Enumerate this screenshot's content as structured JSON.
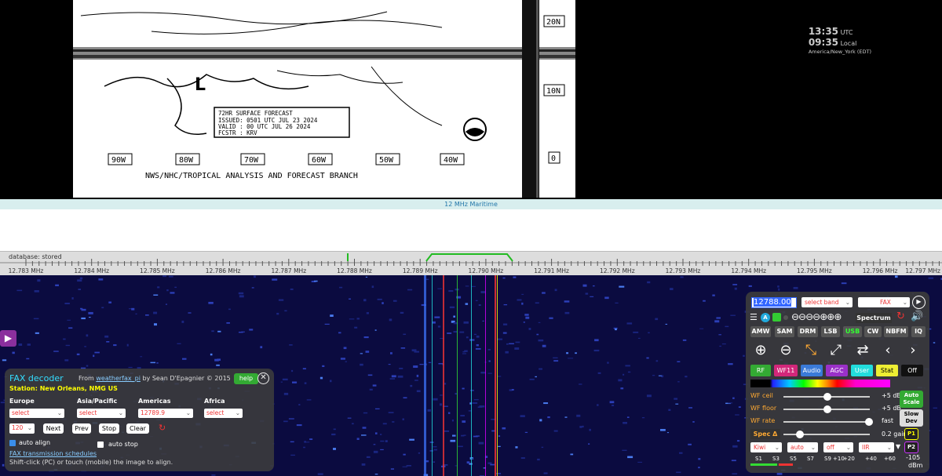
{
  "fax_image": {
    "title_text": "NWS/NHC/TROPICAL ANALYSIS AND FORECAST BRANCH",
    "forecast_box": [
      "72HR SURFACE FORECAST",
      "ISSUED: 0501 UTC JUL 23 2024",
      "VALID : 00 UTC JUL 26 2024",
      "FCSTR : KRV"
    ],
    "longitudes": [
      "90W",
      "80W",
      "70W",
      "60W",
      "50W",
      "40W"
    ],
    "latitudes": [
      "20N",
      "10N",
      "0"
    ]
  },
  "clock": {
    "utc_time": "13:35",
    "utc_label": "UTC",
    "local_time": "09:35",
    "local_label": "Local",
    "timezone": "America/New_York (EDT)"
  },
  "band_bar": {
    "label": "12 MHz Maritime"
  },
  "scale": {
    "db_label": "database: stored",
    "mhz_labels": [
      "12.783 MHz",
      "12.784 MHz",
      "12.785 MHz",
      "12.786 MHz",
      "12.787 MHz",
      "12.788 MHz",
      "12.789 MHz",
      "12.790 MHz",
      "12.791 MHz",
      "12.792 MHz",
      "12.793 MHz",
      "12.794 MHz",
      "12.795 MHz",
      "12.796 MHz",
      "12.797 MHz"
    ]
  },
  "fax_decoder": {
    "title": "FAX decoder",
    "credit_prefix": "From",
    "credit_link": "weatherfax_pi",
    "credit_suffix": "by Sean D'Epagnier © 2015",
    "help_label": "help",
    "station": "Station: New Orleans, NMG US",
    "regions": [
      {
        "label": "Europe",
        "value": "select"
      },
      {
        "label": "Asia/Pacific",
        "value": "select"
      },
      {
        "label": "Americas",
        "value": "12789.9"
      },
      {
        "label": "Africa",
        "value": "select"
      }
    ],
    "lpm": "120",
    "next_label": "Next",
    "prev_label": "Prev",
    "stop_label": "Stop",
    "clear_label": "Clear",
    "auto_align_label": "auto align",
    "auto_stop_label": "auto stop",
    "schedules_link": "FAX transmission schedules",
    "hint": "Shift-click (PC) or touch (mobile) the image to align."
  },
  "control": {
    "frequency": "12788.00",
    "band_select": "select band",
    "mode_select": "FAX",
    "spectrum_label": "Spectrum",
    "modes": [
      "AMW",
      "SAM",
      "DRM",
      "LSB",
      "USB",
      "CW",
      "NBFM",
      "IQ"
    ],
    "active_mode": "USB",
    "tabs": [
      "RF",
      "WF11",
      "Audio",
      "AGC",
      "User",
      "Stat",
      "Off"
    ],
    "wf_ceil": {
      "label": "WF ceil",
      "value": "+5 dB"
    },
    "wf_floor": {
      "label": "WF floor",
      "value": "+5 dB"
    },
    "wf_rate": {
      "label": "WF rate",
      "value": "fast"
    },
    "spec_label": "Spec Δ",
    "spec_value": "0.2 gain",
    "auto_scale": "Auto Scale",
    "slow_dev": "Slow Dev",
    "p1": "P1",
    "p2": "P2",
    "bottom_selects": [
      "Kiwi",
      "auto",
      "off",
      "IIR"
    ],
    "meter_labels": [
      "S1",
      "S3",
      "S5",
      "S7",
      "S9",
      "+10",
      "+20",
      "+40",
      "+60",
      "-105",
      "dBm"
    ]
  },
  "colors": {
    "accent_cyan": "#33ddff",
    "station_yellow": "#ffff00",
    "usb_green": "#33ff33"
  }
}
